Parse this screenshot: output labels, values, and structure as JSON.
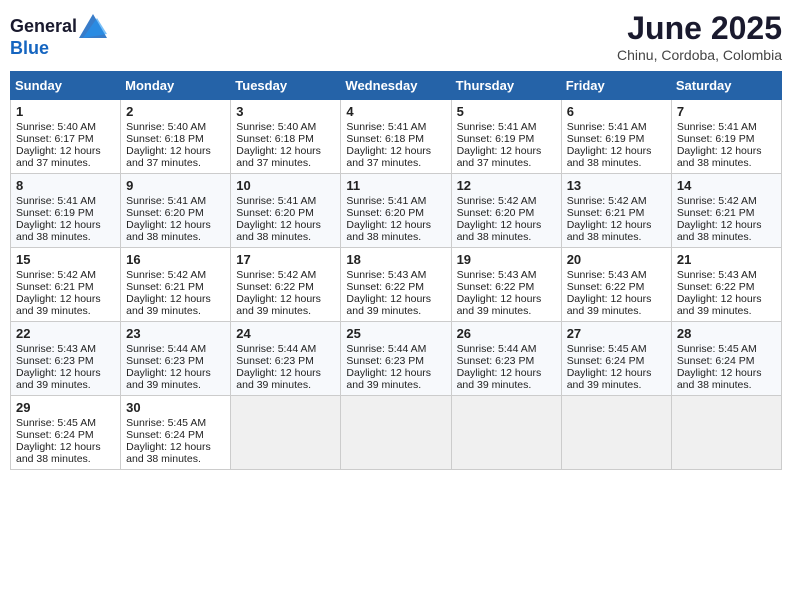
{
  "logo": {
    "general": "General",
    "blue": "Blue"
  },
  "title": "June 2025",
  "subtitle": "Chinu, Cordoba, Colombia",
  "weekdays": [
    "Sunday",
    "Monday",
    "Tuesday",
    "Wednesday",
    "Thursday",
    "Friday",
    "Saturday"
  ],
  "weeks": [
    [
      {
        "day": "1",
        "sunrise": "Sunrise: 5:40 AM",
        "sunset": "Sunset: 6:17 PM",
        "daylight": "Daylight: 12 hours and 37 minutes."
      },
      {
        "day": "2",
        "sunrise": "Sunrise: 5:40 AM",
        "sunset": "Sunset: 6:18 PM",
        "daylight": "Daylight: 12 hours and 37 minutes."
      },
      {
        "day": "3",
        "sunrise": "Sunrise: 5:40 AM",
        "sunset": "Sunset: 6:18 PM",
        "daylight": "Daylight: 12 hours and 37 minutes."
      },
      {
        "day": "4",
        "sunrise": "Sunrise: 5:41 AM",
        "sunset": "Sunset: 6:18 PM",
        "daylight": "Daylight: 12 hours and 37 minutes."
      },
      {
        "day": "5",
        "sunrise": "Sunrise: 5:41 AM",
        "sunset": "Sunset: 6:19 PM",
        "daylight": "Daylight: 12 hours and 37 minutes."
      },
      {
        "day": "6",
        "sunrise": "Sunrise: 5:41 AM",
        "sunset": "Sunset: 6:19 PM",
        "daylight": "Daylight: 12 hours and 38 minutes."
      },
      {
        "day": "7",
        "sunrise": "Sunrise: 5:41 AM",
        "sunset": "Sunset: 6:19 PM",
        "daylight": "Daylight: 12 hours and 38 minutes."
      }
    ],
    [
      {
        "day": "8",
        "sunrise": "Sunrise: 5:41 AM",
        "sunset": "Sunset: 6:19 PM",
        "daylight": "Daylight: 12 hours and 38 minutes."
      },
      {
        "day": "9",
        "sunrise": "Sunrise: 5:41 AM",
        "sunset": "Sunset: 6:20 PM",
        "daylight": "Daylight: 12 hours and 38 minutes."
      },
      {
        "day": "10",
        "sunrise": "Sunrise: 5:41 AM",
        "sunset": "Sunset: 6:20 PM",
        "daylight": "Daylight: 12 hours and 38 minutes."
      },
      {
        "day": "11",
        "sunrise": "Sunrise: 5:41 AM",
        "sunset": "Sunset: 6:20 PM",
        "daylight": "Daylight: 12 hours and 38 minutes."
      },
      {
        "day": "12",
        "sunrise": "Sunrise: 5:42 AM",
        "sunset": "Sunset: 6:20 PM",
        "daylight": "Daylight: 12 hours and 38 minutes."
      },
      {
        "day": "13",
        "sunrise": "Sunrise: 5:42 AM",
        "sunset": "Sunset: 6:21 PM",
        "daylight": "Daylight: 12 hours and 38 minutes."
      },
      {
        "day": "14",
        "sunrise": "Sunrise: 5:42 AM",
        "sunset": "Sunset: 6:21 PM",
        "daylight": "Daylight: 12 hours and 38 minutes."
      }
    ],
    [
      {
        "day": "15",
        "sunrise": "Sunrise: 5:42 AM",
        "sunset": "Sunset: 6:21 PM",
        "daylight": "Daylight: 12 hours and 39 minutes."
      },
      {
        "day": "16",
        "sunrise": "Sunrise: 5:42 AM",
        "sunset": "Sunset: 6:21 PM",
        "daylight": "Daylight: 12 hours and 39 minutes."
      },
      {
        "day": "17",
        "sunrise": "Sunrise: 5:42 AM",
        "sunset": "Sunset: 6:22 PM",
        "daylight": "Daylight: 12 hours and 39 minutes."
      },
      {
        "day": "18",
        "sunrise": "Sunrise: 5:43 AM",
        "sunset": "Sunset: 6:22 PM",
        "daylight": "Daylight: 12 hours and 39 minutes."
      },
      {
        "day": "19",
        "sunrise": "Sunrise: 5:43 AM",
        "sunset": "Sunset: 6:22 PM",
        "daylight": "Daylight: 12 hours and 39 minutes."
      },
      {
        "day": "20",
        "sunrise": "Sunrise: 5:43 AM",
        "sunset": "Sunset: 6:22 PM",
        "daylight": "Daylight: 12 hours and 39 minutes."
      },
      {
        "day": "21",
        "sunrise": "Sunrise: 5:43 AM",
        "sunset": "Sunset: 6:22 PM",
        "daylight": "Daylight: 12 hours and 39 minutes."
      }
    ],
    [
      {
        "day": "22",
        "sunrise": "Sunrise: 5:43 AM",
        "sunset": "Sunset: 6:23 PM",
        "daylight": "Daylight: 12 hours and 39 minutes."
      },
      {
        "day": "23",
        "sunrise": "Sunrise: 5:44 AM",
        "sunset": "Sunset: 6:23 PM",
        "daylight": "Daylight: 12 hours and 39 minutes."
      },
      {
        "day": "24",
        "sunrise": "Sunrise: 5:44 AM",
        "sunset": "Sunset: 6:23 PM",
        "daylight": "Daylight: 12 hours and 39 minutes."
      },
      {
        "day": "25",
        "sunrise": "Sunrise: 5:44 AM",
        "sunset": "Sunset: 6:23 PM",
        "daylight": "Daylight: 12 hours and 39 minutes."
      },
      {
        "day": "26",
        "sunrise": "Sunrise: 5:44 AM",
        "sunset": "Sunset: 6:23 PM",
        "daylight": "Daylight: 12 hours and 39 minutes."
      },
      {
        "day": "27",
        "sunrise": "Sunrise: 5:45 AM",
        "sunset": "Sunset: 6:24 PM",
        "daylight": "Daylight: 12 hours and 39 minutes."
      },
      {
        "day": "28",
        "sunrise": "Sunrise: 5:45 AM",
        "sunset": "Sunset: 6:24 PM",
        "daylight": "Daylight: 12 hours and 38 minutes."
      }
    ],
    [
      {
        "day": "29",
        "sunrise": "Sunrise: 5:45 AM",
        "sunset": "Sunset: 6:24 PM",
        "daylight": "Daylight: 12 hours and 38 minutes."
      },
      {
        "day": "30",
        "sunrise": "Sunrise: 5:45 AM",
        "sunset": "Sunset: 6:24 PM",
        "daylight": "Daylight: 12 hours and 38 minutes."
      },
      null,
      null,
      null,
      null,
      null
    ]
  ]
}
